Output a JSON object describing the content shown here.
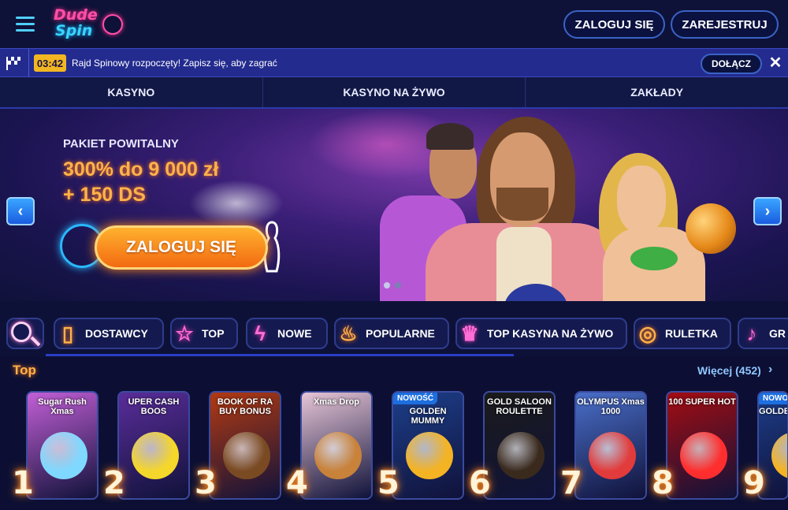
{
  "header": {
    "logo_line1": "Dude",
    "logo_line2": "Spin",
    "login_label": "ZALOGUJ SIĘ",
    "register_label": "ZAREJESTRUJ"
  },
  "tournament_bar": {
    "timer": "03:42",
    "message": "Rajd Spinowy rozpoczęty! Zapisz się, aby zagrać",
    "join_label": "DOŁĄCZ",
    "close_glyph": "✕"
  },
  "nav": {
    "tabs": [
      {
        "label": "KASYNO"
      },
      {
        "label": "KASYNO NA ŻYWO"
      },
      {
        "label": "ZAKŁADY"
      }
    ]
  },
  "banner": {
    "subtitle": "PAKIET POWITALNY",
    "line1": "300% do 9 000 zł",
    "line2": "+ 150 DS",
    "cta_label": "ZALOGUJ SIĘ",
    "prev_glyph": "‹",
    "next_glyph": "›",
    "slide_count": 2,
    "active_slide": 1
  },
  "categories": [
    {
      "label": "DOSTAWCY",
      "icon": "book-icon",
      "glyph": "▯"
    },
    {
      "label": "TOP",
      "icon": "star-icon",
      "glyph": "☆"
    },
    {
      "label": "NOWE",
      "icon": "lightning-icon",
      "glyph": "ϟ"
    },
    {
      "label": "POPULARNE",
      "icon": "flame-icon",
      "glyph": "♨"
    },
    {
      "label": "TOP KASYNA NA ŻYWO",
      "icon": "crown-icon",
      "glyph": "♛"
    },
    {
      "label": "RULETKA",
      "icon": "roulette-icon",
      "glyph": "◎"
    },
    {
      "label": "GR",
      "icon": "microphone-icon",
      "glyph": "♪"
    }
  ],
  "top_section": {
    "title": "Top",
    "more_label": "Więcej (452)",
    "more_chevron": "›"
  },
  "games": [
    {
      "rank": "1",
      "title": "Sugar Rush Xmas",
      "badge": "",
      "bg": "#c25fd6",
      "art": "#7fd8ff"
    },
    {
      "rank": "2",
      "title": "UPER CASH BOOS",
      "badge": "",
      "bg": "#5a2d9a",
      "art": "#f5d62b"
    },
    {
      "rank": "3",
      "title": "BOOK OF RA BUY BONUS",
      "badge": "",
      "bg": "#b23a12",
      "art": "#7a4a22"
    },
    {
      "rank": "4",
      "title": "Xmas Drop",
      "badge": "",
      "bg": "#e7c6d7",
      "art": "#c8823a"
    },
    {
      "rank": "5",
      "title": "GOLDEN MUMMY",
      "badge": "NOWOŚĆ",
      "bg": "#1d3f8a",
      "art": "#f4b323"
    },
    {
      "rank": "6",
      "title": "GOLD SALOON ROULETTE",
      "badge": "",
      "bg": "#1b1b1b",
      "art": "#3a2a1e"
    },
    {
      "rank": "7",
      "title": "OLYMPUS Xmas 1000",
      "badge": "",
      "bg": "#4a6fc9",
      "art": "#e23b3b"
    },
    {
      "rank": "8",
      "title": "100 SUPER HOT",
      "badge": "",
      "bg": "#a30d12",
      "art": "#ff2e2e"
    },
    {
      "rank": "9",
      "title": "GOLDEN",
      "badge": "NOWOŚĆ",
      "bg": "#1d3f8a",
      "art": "#f4b323"
    }
  ]
}
